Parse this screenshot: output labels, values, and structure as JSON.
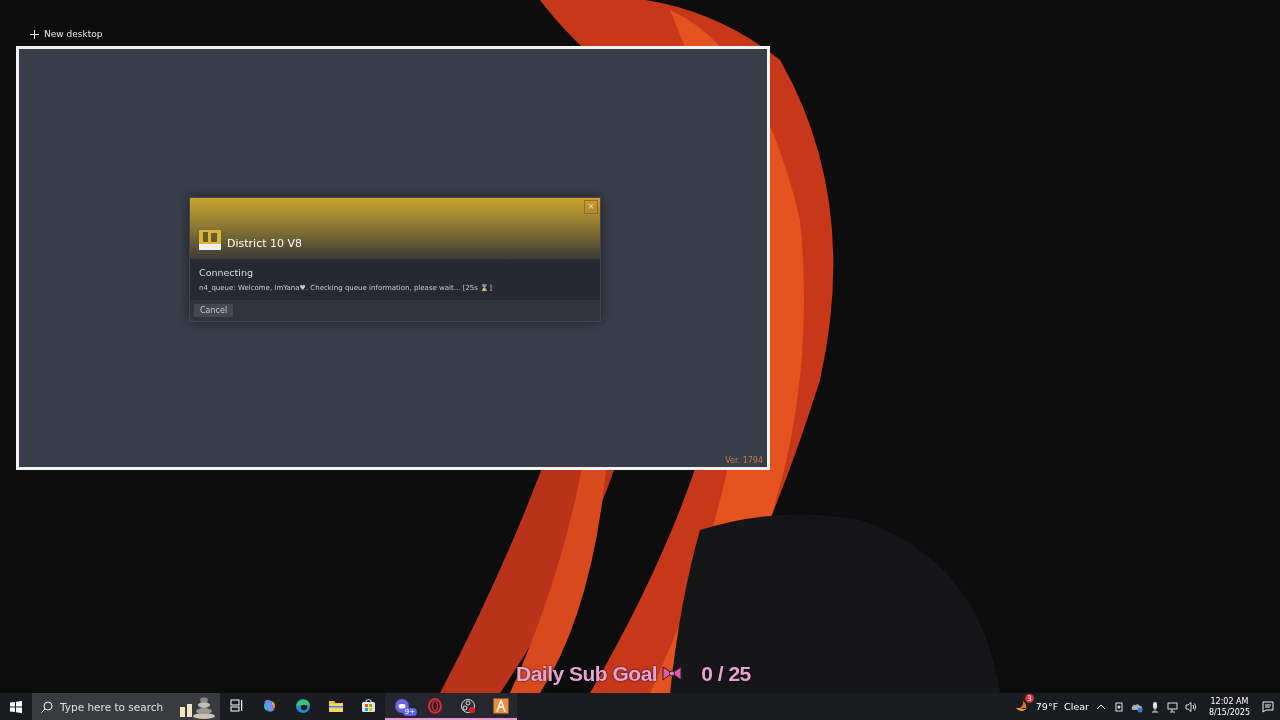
{
  "desktop_bar": {
    "new_desktop": "New desktop"
  },
  "window_preview": {
    "dialog": {
      "title": "District 10 V8",
      "close": "×",
      "status": "Connecting",
      "message": "n4_queue: Welcome, ImYana♥. Checking queue information, please wait... [25s ⌛]",
      "buttons": [
        "Cancel"
      ]
    },
    "version": "Ver. 1794"
  },
  "overlay": {
    "label": "Daily Sub Goal",
    "count": "0 / 25"
  },
  "taskbar": {
    "search": {
      "placeholder": "Type here to search"
    },
    "apps": [
      {
        "kind": "taskview",
        "running": false
      },
      {
        "kind": "copilot",
        "running": false
      },
      {
        "kind": "edge",
        "running": false
      },
      {
        "kind": "files",
        "running": false
      },
      {
        "kind": "store",
        "running": false
      },
      {
        "kind": "chat",
        "running": true,
        "badge": "9+"
      },
      {
        "kind": "opera",
        "running": true
      },
      {
        "kind": "recorder",
        "running": true
      },
      {
        "kind": "launcher",
        "running": true
      }
    ],
    "tray": {
      "weather_badge": "3",
      "temperature": "79°F",
      "condition": "Clear",
      "time": "12:02 AM",
      "date": "8/15/2025"
    }
  }
}
